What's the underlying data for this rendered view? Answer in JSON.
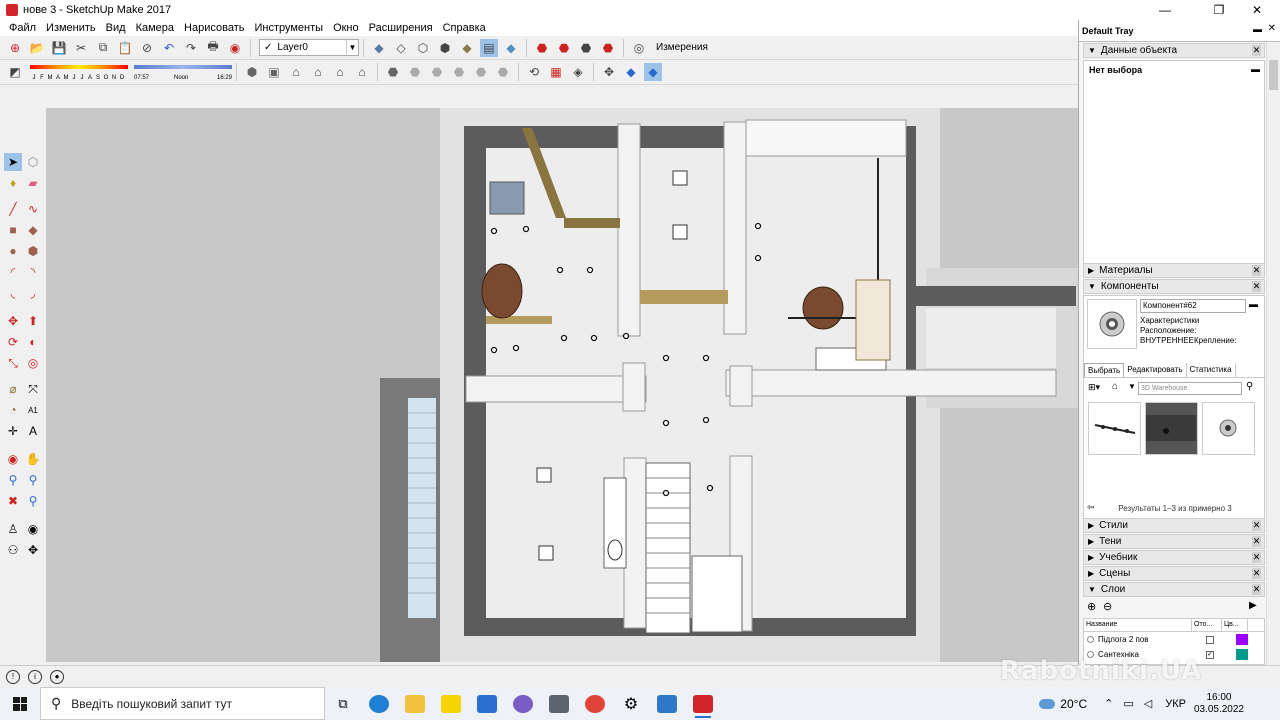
{
  "window": {
    "title": "нове 3 - SketchUp Make 2017",
    "minimize": "—",
    "maximize": "❐",
    "close": "✕"
  },
  "menu": [
    "Файл",
    "Изменить",
    "Вид",
    "Камера",
    "Нарисовать",
    "Инструменты",
    "Окно",
    "Расширения",
    "Справка"
  ],
  "toolbar": {
    "layer_selected": "Layer0",
    "measurements_label": "Измерения",
    "months": [
      "J",
      "F",
      "M",
      "A",
      "M",
      "J",
      "J",
      "A",
      "S",
      "O",
      "N",
      "D"
    ],
    "time_start": "07:57",
    "time_noon": "Noon",
    "time_end": "16:29"
  },
  "tray": {
    "title": "Default Tray",
    "entity_info": {
      "label": "Данные объекта",
      "content": "Нет выбора"
    },
    "materials": {
      "label": "Материалы"
    },
    "components": {
      "label": "Компоненты",
      "name": "Компонент#62",
      "description": "Характеристики Расположение: ВНУТРЕННЕЕКрепление:",
      "tabs": [
        "Выбрать",
        "Редактировать",
        "Статистика"
      ],
      "search_placeholder": "3D Warehouse",
      "results_caption": "Результаты 1–3 из примерно 3"
    },
    "styles": {
      "label": "Стили"
    },
    "shadows": {
      "label": "Тени"
    },
    "instructor": {
      "label": "Учебник"
    },
    "scenes": {
      "label": "Сцены"
    },
    "layers": {
      "label": "Слои",
      "col_name": "Название",
      "col_other": "Ото...",
      "col_color": "Цв...",
      "rows": [
        {
          "name": "Підлога 2 пов",
          "checked": "",
          "color": "#9b00ff"
        },
        {
          "name": "Сантехніка",
          "checked": "✓",
          "color": "#009a8a"
        }
      ]
    }
  },
  "taskbar": {
    "search_placeholder": "Введіть пошуковий запит тут",
    "weather": "20°C",
    "language": "УКР",
    "time": "16:00",
    "date": "03.05.2022"
  },
  "watermark": "Rabotniki.UA"
}
